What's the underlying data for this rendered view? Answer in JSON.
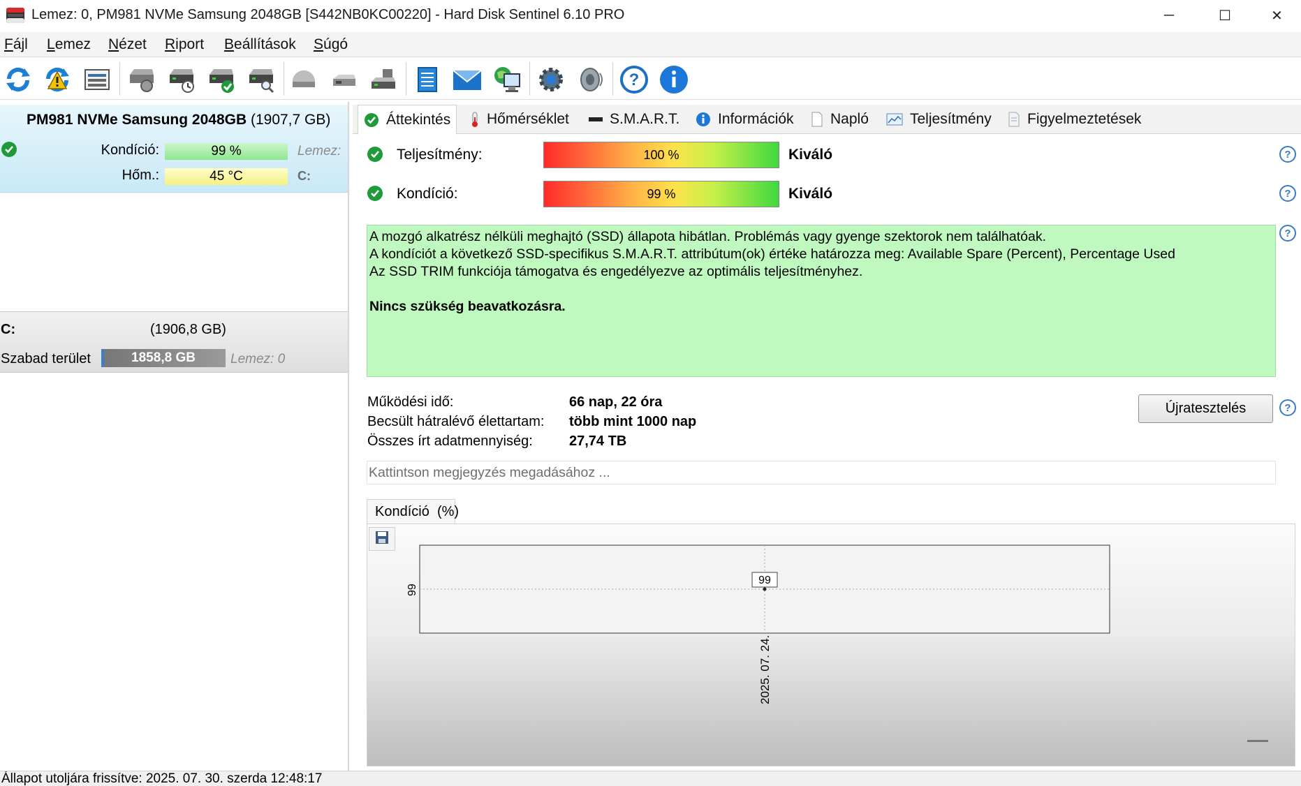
{
  "window": {
    "title": "Lemez: 0, PM981 NVMe Samsung 2048GB [S442NB0KC00220]  -  Hard Disk Sentinel 6.10 PRO",
    "minimize": "─",
    "maximize": "☐",
    "close": "✕"
  },
  "menu": [
    {
      "label": "Fájl",
      "key": "F",
      "rest": "ájl"
    },
    {
      "label": "Lemez",
      "key": "L",
      "rest": "emez"
    },
    {
      "label": "Nézet",
      "key": "N",
      "rest": "ézet"
    },
    {
      "label": "Riport",
      "key": "R",
      "rest": "iport"
    },
    {
      "label": "Beállítások",
      "key": "B",
      "rest": "eállítások"
    },
    {
      "label": "Súgó",
      "key": "S",
      "rest": "úgó"
    }
  ],
  "toolbar_icons": [
    "refresh-icon",
    "refresh-warning-icon",
    "disk-list-icon",
    "disk-settings-icon",
    "disk-schedule-icon",
    "disk-ok-icon",
    "disk-search-icon",
    "disk-surface-icon",
    "disk-tool-icon",
    "disk-test-icon",
    "report-icon",
    "email-icon",
    "network-icon",
    "settings-icon",
    "sound-icon",
    "help-icon",
    "about-icon"
  ],
  "left": {
    "disk": {
      "name": "PM981 NVMe Samsung 2048GB",
      "size": "(1907,7 GB)",
      "health_label": "Kondíció:",
      "health_value": "99 %",
      "temp_label": "Hőm.:",
      "temp_value": "45 °C",
      "lemez_label": "Lemez:",
      "drive_letter": "C:",
      "health_color": "#a6f0a6",
      "temp_color": "#fbf7a0"
    },
    "partition": {
      "letter": "C:",
      "size": "(1906,8 GB)",
      "free_label": "Szabad terület",
      "free_value": "1858,8 GB",
      "disk_ref": "Lemez: 0"
    }
  },
  "tabs": [
    {
      "label": "Áttekintés",
      "icon": "ok-icon",
      "active": true
    },
    {
      "label": "Hőmérséklet",
      "icon": "thermometer-icon",
      "active": false
    },
    {
      "label": "S.M.A.R.T.",
      "icon": "smart-icon",
      "active": false
    },
    {
      "label": "Információk",
      "icon": "info-icon",
      "active": false
    },
    {
      "label": "Napló",
      "icon": "log-icon",
      "active": false
    },
    {
      "label": "Teljesítmény",
      "icon": "performance-icon",
      "active": false
    },
    {
      "label": "Figyelmeztetések",
      "icon": "alerts-icon",
      "active": false
    }
  ],
  "overview": {
    "performance_label": "Teljesítmény:",
    "performance_value": "100 %",
    "performance_fraction": 1.0,
    "performance_rating": "Kiváló",
    "health_label": "Kondíció:",
    "health_value": "99 %",
    "health_fraction": 0.99,
    "health_rating": "Kiváló",
    "status_lines": [
      "A mozgó alkatrész nélküli meghajtó (SSD) állapota hibátlan. Problémás vagy gyenge szektorok nem találhatóak.",
      "A kondíciót a következő SSD-specifikus S.M.A.R.T. attribútum(ok) értéke határozza meg:  Available Spare (Percent), Percentage Used",
      "Az SSD TRIM funkciója támogatva és engedélyezve az optimális teljesítményhez."
    ],
    "status_action": "Nincs szükség beavatkozásra.",
    "status_color": "#bff9bf",
    "uptime_label": "Működési idő:",
    "uptime_value": "66 nap, 22 óra",
    "lifetime_label": "Becsült hátralévő élettartam:",
    "lifetime_value": "több mint 1000 nap",
    "written_label": "Összes írt adatmennyiség:",
    "written_value": "27,74 TB",
    "retest_button": "Újratesztelés",
    "note_placeholder": "Kattintson megjegyzés megadásához ..."
  },
  "chart_tab": {
    "title": "Kondíció",
    "unit": "(%)"
  },
  "chart_data": {
    "type": "line",
    "x": [
      "2025. 07. 24."
    ],
    "values": [
      99
    ],
    "y_tick_labels": [
      "99"
    ],
    "data_labels": [
      "99"
    ],
    "grid": true
  },
  "statusbar": {
    "text": "Állapot utoljára frissítve: 2025. 07. 30. szerda 12:48:17"
  }
}
